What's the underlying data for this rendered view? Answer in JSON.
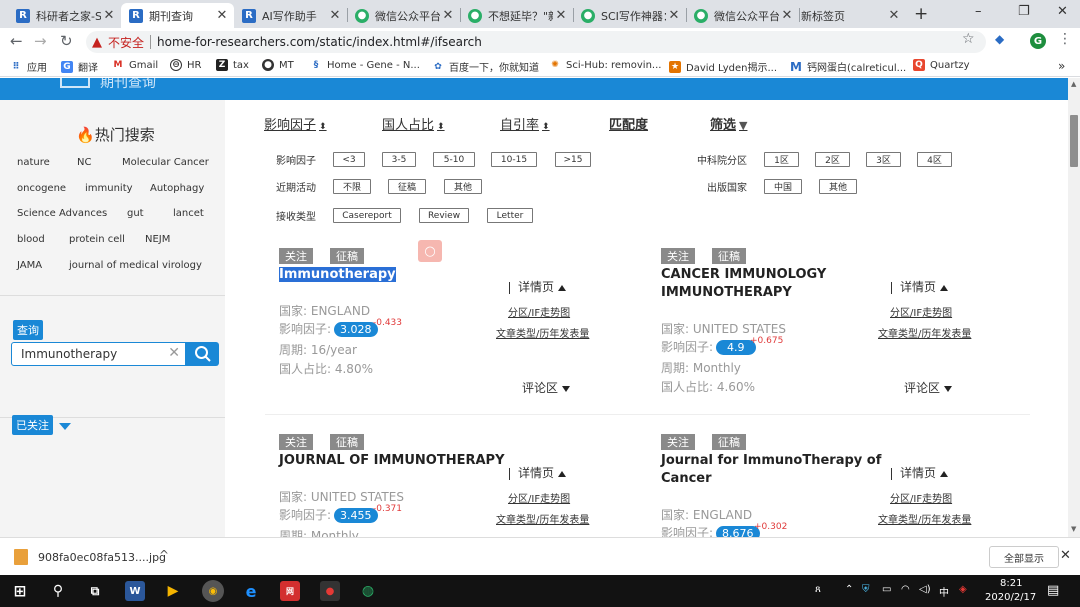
{
  "browser": {
    "tabs": [
      {
        "title": "科研者之家-SC",
        "icon": "R"
      },
      {
        "title": "期刊查询",
        "icon": "R",
        "active": true
      },
      {
        "title": "AI写作助手",
        "icon": "R"
      },
      {
        "title": "微信公众平台",
        "icon": "wechat"
      },
      {
        "title": "不想延毕？\"新",
        "icon": "wechat"
      },
      {
        "title": "SCI写作神器：",
        "icon": "wechat"
      },
      {
        "title": "微信公众平台",
        "icon": "wechat"
      },
      {
        "title": "新标签页",
        "icon": ""
      }
    ],
    "new_tab": "+",
    "window_controls": {
      "minimize": "–",
      "restore": "❐",
      "close": "✕"
    },
    "security_label": "不安全",
    "url": "home-for-researchers.com/static/index.html#/ifsearch",
    "bookmarks": [
      {
        "label": "应用",
        "icon": "apps-icon"
      },
      {
        "label": "翻译",
        "icon": "translate-icon"
      },
      {
        "label": "Gmail",
        "icon": "gmail-icon"
      },
      {
        "label": "HR",
        "icon": "hr-icon"
      },
      {
        "label": "tax",
        "icon": "tax-icon"
      },
      {
        "label": "MT",
        "icon": "mt-icon"
      },
      {
        "label": "Home - Gene - N...",
        "icon": "ncbi-icon"
      },
      {
        "label": "百度一下，你就知道",
        "icon": "baidu-icon"
      },
      {
        "label": "Sci-Hub: removin...",
        "icon": "scihub-icon"
      },
      {
        "label": "David Lyden揭示...",
        "icon": "bookmark-icon"
      },
      {
        "label": "钙网蛋白(calreticul...",
        "icon": "m-icon"
      },
      {
        "label": "Quartzy",
        "icon": "quartzy-icon"
      }
    ],
    "bookmarks_more": "»",
    "profile_letter": "G"
  },
  "site": {
    "header_title": "期刊查询"
  },
  "sidebar": {
    "hot_title": "热门搜索",
    "keywords": [
      "nature",
      "NC",
      "Molecular Cancer",
      "oncogene",
      "immunity",
      "Autophagy",
      "Science Advances",
      "gut",
      "lancet",
      "blood",
      "protein cell",
      "NEJM",
      "JAMA",
      "journal of medical virology"
    ],
    "query_label": "查询",
    "search_value": "Immunotherapy",
    "clear_glyph": "✕",
    "followed_label": "已关注"
  },
  "sort": {
    "items": [
      "影响因子",
      "国人占比",
      "自引率",
      "匹配度",
      "筛选"
    ]
  },
  "filters": {
    "if_label": "影响因子",
    "if_options": [
      "<3",
      "3-5",
      "5-10",
      "10-15",
      ">15"
    ],
    "cas_label": "中科院分区",
    "cas_options": [
      "1区",
      "2区",
      "3区",
      "4区"
    ],
    "recent_label": "近期活动",
    "recent_options": [
      "不限",
      "征稿",
      "其他"
    ],
    "country_label": "出版国家",
    "country_options": [
      "中国",
      "其他"
    ],
    "accept_label": "接收类型",
    "accept_options": [
      "Casereport",
      "Review",
      "Letter"
    ]
  },
  "cards": [
    {
      "tags": [
        "关注",
        "征稿"
      ],
      "title": "Immunotherapy",
      "country_label": "国家: ENGLAND",
      "if_label": "影响因子:",
      "if_value": "3.028",
      "if_delta": "-0.433",
      "period_label": "周期: 16/year",
      "ratio_label": "国人占比: 4.80%",
      "detail_label": "详情页",
      "zone_link": "分区/IF走势图",
      "type_link": "文章类型/历年发表量",
      "comment_label": "评论区"
    },
    {
      "tags": [
        "关注",
        "征稿"
      ],
      "title": "CANCER IMMUNOLOGY IMMUNOTHERAPY",
      "country_label": "国家: UNITED STATES",
      "if_label": "影响因子:",
      "if_value": "4.9",
      "if_delta": "+0.675",
      "period_label": "周期: Monthly",
      "ratio_label": "国人占比: 4.60%",
      "detail_label": "详情页",
      "zone_link": "分区/IF走势图",
      "type_link": "文章类型/历年发表量",
      "comment_label": "评论区"
    },
    {
      "tags": [
        "关注",
        "征稿"
      ],
      "title": "JOURNAL OF IMMUNOTHERAPY",
      "country_label": "国家: UNITED STATES",
      "if_label": "影响因子:",
      "if_value": "3.455",
      "if_delta": "-0.371",
      "period_label": "周期: Monthly",
      "detail_label": "详情页",
      "zone_link": "分区/IF走势图",
      "type_link": "文章类型/历年发表量"
    },
    {
      "tags": [
        "关注",
        "征稿"
      ],
      "title": "Journal for ImmunoTherapy of Cancer",
      "country_label": "国家: ENGLAND",
      "if_label": "影响因子:",
      "if_value": "8.676",
      "if_delta": "+0.302",
      "detail_label": "详情页",
      "zone_link": "分区/IF走势图",
      "type_link": "文章类型/历年发表量"
    }
  ],
  "downloads": {
    "filename": "908fa0ec08fa513....jpg",
    "show_all": "全部显示"
  },
  "taskbar": {
    "ime": "中",
    "time": "8:21",
    "date": "2020/2/17"
  },
  "colors": {
    "accent": "#1a88d6",
    "delta": "#e03a3a"
  }
}
